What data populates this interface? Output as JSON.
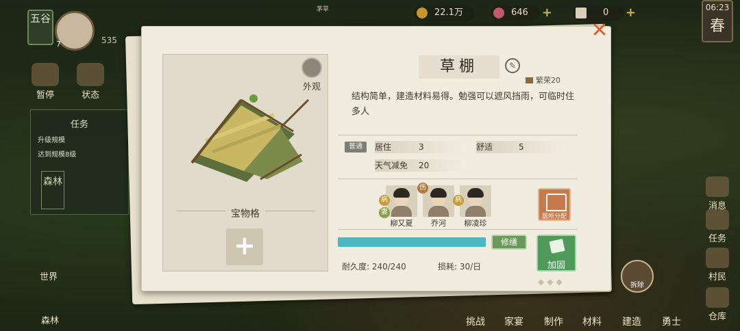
{
  "hud": {
    "coins": "22.1万",
    "gems": "646",
    "tickets": "0",
    "time": "06:23",
    "season": "春",
    "small_top_label": "茅草",
    "region_tag": "五谷",
    "player_level": "7",
    "grain": "535"
  },
  "left_menu": {
    "item1": "暂停",
    "item2": "状态",
    "task_title": "任务",
    "task_line1": "升级规模",
    "task_line2": "达到规模8级",
    "forest_tag": "森林",
    "world": "世界",
    "forest_bottom": "森林"
  },
  "right_menu": {
    "news": "消息",
    "tasks": "任务",
    "villagers": "村民",
    "warehouse": "仓库"
  },
  "bottom_bar": {
    "challenge": "挑战",
    "banquet": "家宴",
    "craft": "制作",
    "materials": "材料",
    "build": "建造",
    "warrior": "勇士",
    "demolish": "拆除"
  },
  "dialog": {
    "title": "草棚",
    "prosperity": "繁荣20",
    "appearance_label": "外观",
    "treasure_label": "宝物格",
    "add_symbol": "+",
    "description": "结构简单，建造材料易得。勉强可以遮风挡雨，可临时住多人",
    "quality_tag": "普通",
    "stats": {
      "live_label": "居住",
      "live_value": "3",
      "comfort_label": "舒适",
      "comfort_value": "5",
      "weather_label": "天气减免",
      "weather_value": "20"
    },
    "residents": [
      {
        "name": "柳又夏",
        "status": "病",
        "badge2": "妻"
      },
      {
        "name": "乔河",
        "status": "伤"
      },
      {
        "name": "柳凌珍",
        "status": "病"
      }
    ],
    "allocate_label": "居所分配",
    "durability_text": "耐久度: 240/240",
    "durability_fraction": 1.0,
    "loss_text": "损耗: 30/日",
    "repair_label": "修缮",
    "reinforce_label": "加固",
    "close_symbol": "✕"
  },
  "colors": {
    "durability": "#4cb8c4",
    "repair": "#6a9a5a",
    "reinforce": "#4f9a5a",
    "allocate": "#c77b4d",
    "close": "#e2602e"
  }
}
